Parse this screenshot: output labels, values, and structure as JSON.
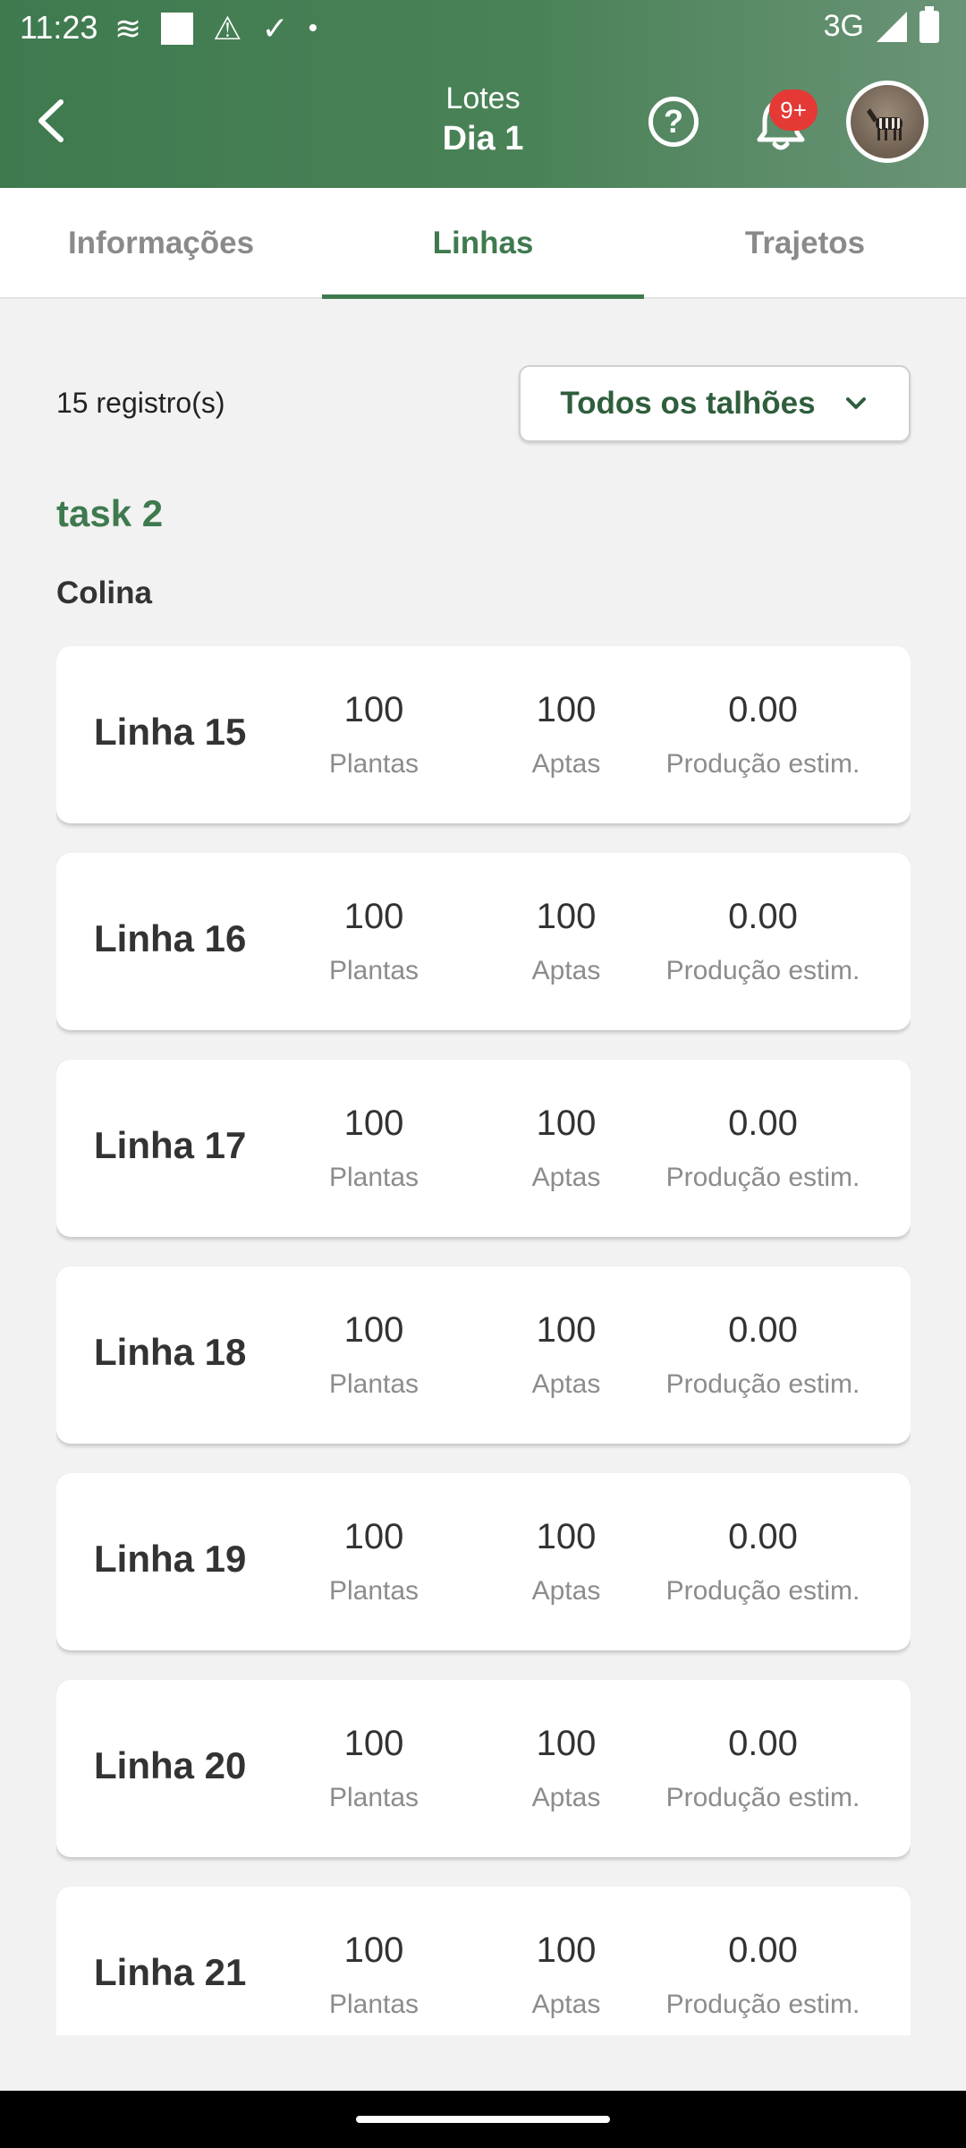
{
  "status_bar": {
    "time": "11:23",
    "network": "3G",
    "icons": [
      "wifi-calling-icon",
      "notification-square-icon",
      "warning-icon",
      "download-done-icon",
      "dot-icon",
      "signal-icon",
      "battery-icon"
    ]
  },
  "header": {
    "title_small": "Lotes",
    "title": "Dia 1",
    "help_label": "?",
    "notification_badge": "9+",
    "colors": {
      "bar": "#3f7a4f",
      "badge": "#e53935"
    }
  },
  "tabs": [
    {
      "label": "Informações",
      "active": false
    },
    {
      "label": "Linhas",
      "active": true
    },
    {
      "label": "Trajetos",
      "active": false
    }
  ],
  "summary": {
    "count_text": "15 registro(s)"
  },
  "filter": {
    "label": "Todos os talhões"
  },
  "group": {
    "title": "task 2",
    "subgroup": "Colina"
  },
  "stat_labels": {
    "plants": "Plantas",
    "fit": "Aptas",
    "production": "Produção estim."
  },
  "rows": [
    {
      "name": "Linha 15",
      "plants": "100",
      "fit": "100",
      "production": "0.00"
    },
    {
      "name": "Linha 16",
      "plants": "100",
      "fit": "100",
      "production": "0.00"
    },
    {
      "name": "Linha 17",
      "plants": "100",
      "fit": "100",
      "production": "0.00"
    },
    {
      "name": "Linha 18",
      "plants": "100",
      "fit": "100",
      "production": "0.00"
    },
    {
      "name": "Linha 19",
      "plants": "100",
      "fit": "100",
      "production": "0.00"
    },
    {
      "name": "Linha 20",
      "plants": "100",
      "fit": "100",
      "production": "0.00"
    },
    {
      "name": "Linha 21",
      "plants": "100",
      "fit": "100",
      "production": "0.00"
    }
  ]
}
